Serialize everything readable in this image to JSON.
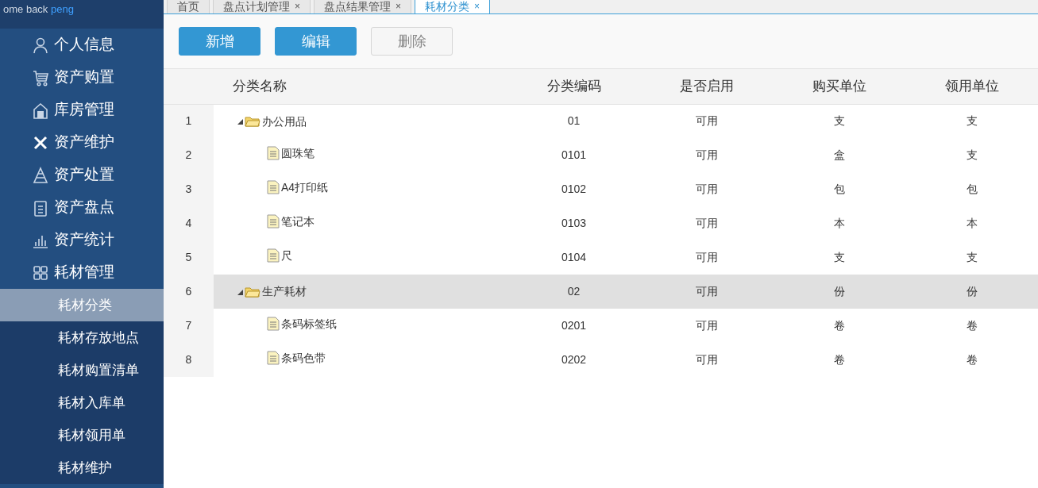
{
  "sidebar": {
    "greeting": "ome back",
    "user": "peng",
    "items": [
      {
        "label": "个人信息"
      },
      {
        "label": "资产购置"
      },
      {
        "label": "库房管理"
      },
      {
        "label": "资产维护"
      },
      {
        "label": "资产处置"
      },
      {
        "label": "资产盘点"
      },
      {
        "label": "资产统计"
      },
      {
        "label": "耗材管理",
        "children": [
          {
            "label": "耗材分类",
            "selected": true
          },
          {
            "label": "耗材存放地点",
            "selected": false
          },
          {
            "label": "耗材购置清单",
            "selected": false
          },
          {
            "label": "耗材入库单",
            "selected": false
          },
          {
            "label": "耗材领用单",
            "selected": false
          },
          {
            "label": "耗材维护",
            "selected": false
          }
        ]
      }
    ]
  },
  "tabs": [
    {
      "label": "首页",
      "closable": false,
      "selected": false
    },
    {
      "label": "盘点计划管理",
      "closable": true,
      "selected": false
    },
    {
      "label": "盘点结果管理",
      "closable": true,
      "selected": false
    },
    {
      "label": "耗材分类",
      "closable": true,
      "selected": true
    }
  ],
  "tab_close": "×",
  "toolbar": [
    {
      "label": "新增",
      "disabled": false
    },
    {
      "label": "编辑",
      "disabled": false
    },
    {
      "label": "删除",
      "disabled": true
    }
  ],
  "table": {
    "columns": [
      "分类名称",
      "分类编码",
      "是否启用",
      "购买单位",
      "领用单位"
    ],
    "rows": [
      {
        "no": "1",
        "name": "办公用品",
        "code": "01",
        "enabled": "可用",
        "buy_unit": "支",
        "use_unit": "支",
        "expanded": true,
        "selected": false,
        "children": [
          {
            "no": "2",
            "name": "圆珠笔",
            "code": "0101",
            "enabled": "可用",
            "buy_unit": "盒",
            "use_unit": "支",
            "selected": false
          },
          {
            "no": "3",
            "name": "A4打印纸",
            "code": "0102",
            "enabled": "可用",
            "buy_unit": "包",
            "use_unit": "包",
            "selected": false
          },
          {
            "no": "4",
            "name": "笔记本",
            "code": "0103",
            "enabled": "可用",
            "buy_unit": "本",
            "use_unit": "本",
            "selected": false
          },
          {
            "no": "5",
            "name": "尺",
            "code": "0104",
            "enabled": "可用",
            "buy_unit": "支",
            "use_unit": "支",
            "selected": false
          }
        ]
      },
      {
        "no": "6",
        "name": "生产耗材",
        "code": "02",
        "enabled": "可用",
        "buy_unit": "份",
        "use_unit": "份",
        "expanded": true,
        "selected": true,
        "children": [
          {
            "no": "7",
            "name": "条码标签纸",
            "code": "0201",
            "enabled": "可用",
            "buy_unit": "卷",
            "use_unit": "卷",
            "selected": false
          },
          {
            "no": "8",
            "name": "条码色带",
            "code": "0202",
            "enabled": "可用",
            "buy_unit": "卷",
            "use_unit": "卷",
            "selected": false
          }
        ]
      }
    ]
  }
}
